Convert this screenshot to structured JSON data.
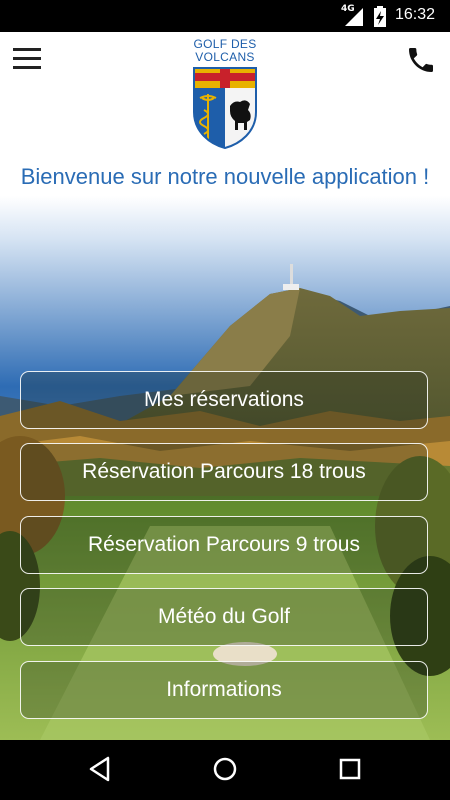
{
  "status_bar": {
    "network": "4G",
    "time": "16:32"
  },
  "header": {
    "logo_line1": "GOLF DES",
    "logo_line2": "VOLCANS",
    "welcome": "Bienvenue sur notre nouvelle application !"
  },
  "menu": {
    "items": [
      {
        "label": "Mes réservations"
      },
      {
        "label": "Réservation Parcours 18 trous"
      },
      {
        "label": "Réservation Parcours 9 trous"
      },
      {
        "label": "Météo du Golf"
      },
      {
        "label": "Informations"
      }
    ]
  },
  "icons": {
    "menu": "hamburger-icon",
    "phone": "phone-icon",
    "back": "back-icon",
    "home": "home-icon",
    "recents": "recents-icon"
  },
  "colors": {
    "brand_blue": "#1e5eaa",
    "welcome_blue": "#2a6cb5"
  }
}
